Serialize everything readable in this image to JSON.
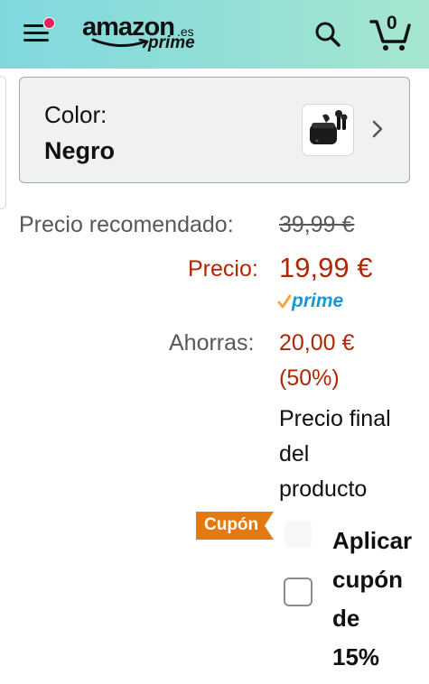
{
  "header": {
    "logo_word": "amazon",
    "logo_tld": ".es",
    "logo_prime": "prime",
    "cart_count": "0",
    "colors": {
      "gradient_start": "#80d8df",
      "gradient_end": "#a6e6cf",
      "notification_dot": "#e0245e"
    },
    "icons": [
      "menu-icon",
      "search-icon",
      "cart-icon"
    ]
  },
  "color_selector": {
    "label": "Color:",
    "value": "Negro",
    "thumbnail": "earbuds-case-black",
    "chevron": "chevron-right-icon"
  },
  "pricing": {
    "list_price_label": "Precio recomendado:",
    "list_price": "39,99 €",
    "price_label": "Precio:",
    "price": "19,99 €",
    "prime_label": "prime",
    "savings_label": "Ahorras:",
    "savings_amount": "20,00 €",
    "savings_percent": "(50%)",
    "final_note_lines": [
      "Precio final",
      "del",
      "producto"
    ],
    "accent_color": "#b12704"
  },
  "coupon": {
    "badge": "Cupón",
    "badge_color": "#e47911",
    "apply_lines": [
      "Aplicar",
      "cupón",
      "de",
      "15%"
    ],
    "checked": false
  }
}
